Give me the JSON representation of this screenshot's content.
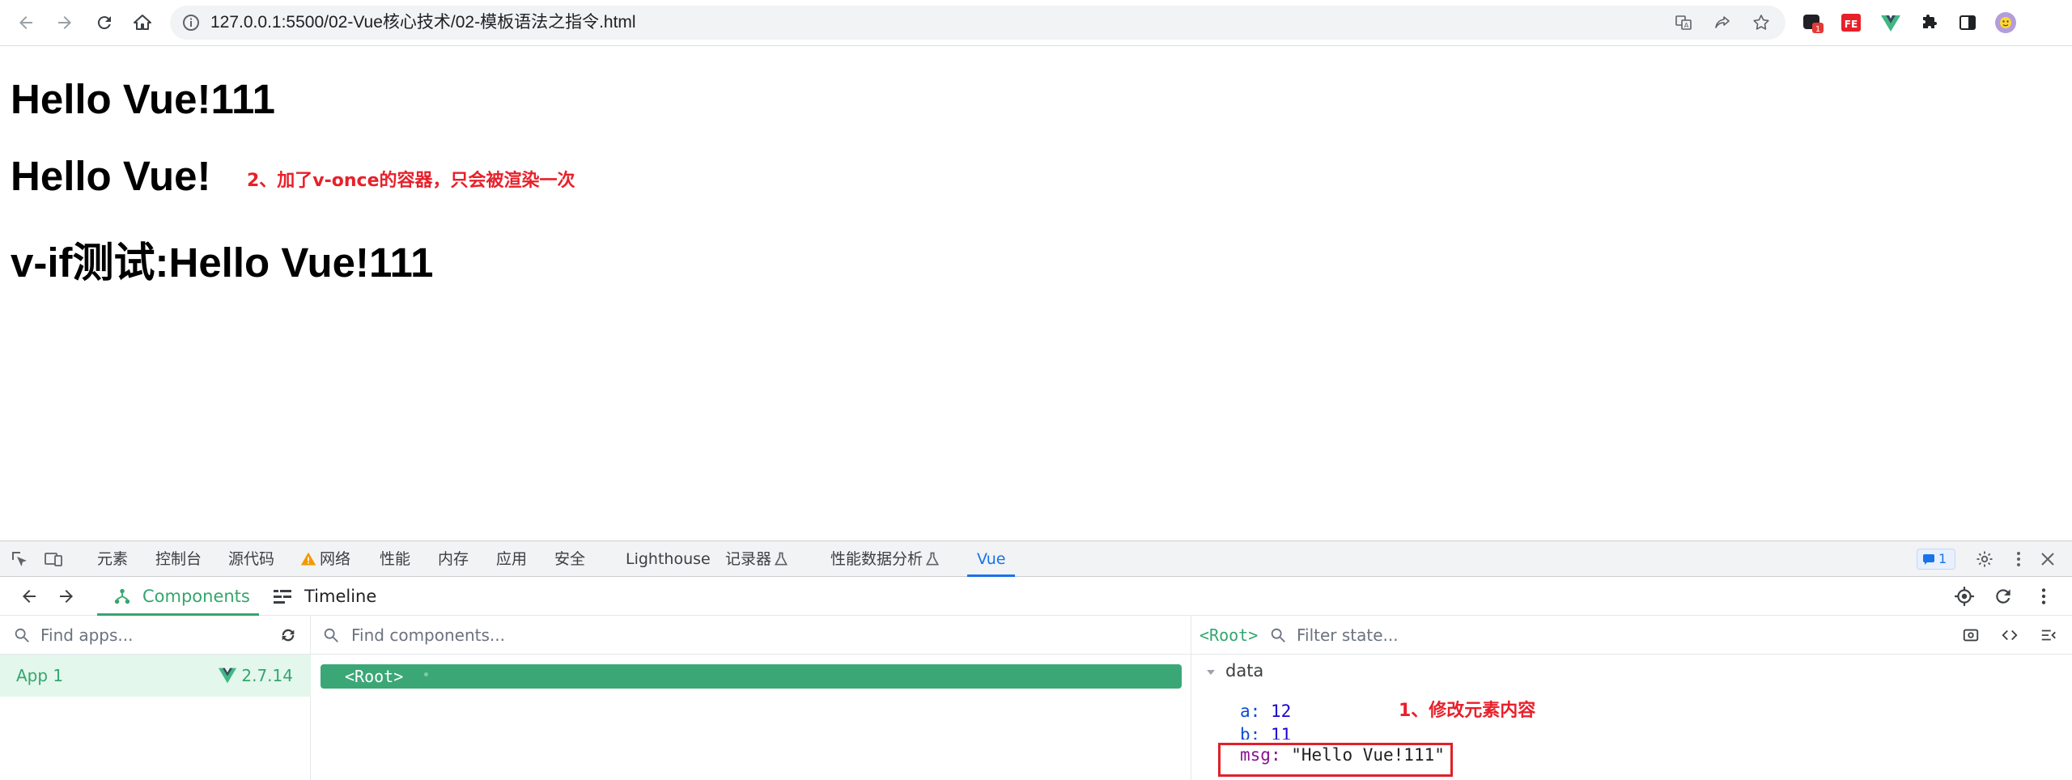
{
  "browser": {
    "url": "127.0.0.1:5500/02-Vue核心技术/02-模板语法之指令.html",
    "ext_badge": "1",
    "colors": {
      "accent": "#1a73e8",
      "vue_green": "#35a66d"
    }
  },
  "page": {
    "line1": "Hello Vue!111",
    "line2": "Hello Vue!",
    "line3": "v-if测试:Hello Vue!111",
    "annotation_once": "2、加了v-once的容器，只会被渲染一次",
    "annotation_edit": "1、修改元素内容"
  },
  "devtools": {
    "tabs": [
      "元素",
      "控制台",
      "源代码",
      "网络",
      "性能",
      "内存",
      "应用",
      "安全",
      "Lighthouse",
      "记录器",
      "性能数据分析",
      "Vue"
    ],
    "issues_count": "1",
    "vue": {
      "tab_components": "Components",
      "tab_timeline": "Timeline",
      "find_apps_placeholder": "Find apps...",
      "find_components_placeholder": "Find components...",
      "filter_state_placeholder": "Filter state...",
      "app_name": "App 1",
      "vue_version": "2.7.14",
      "root_component": "<Root>",
      "state_root": "<Root>",
      "data_section": "data",
      "state": [
        {
          "key": "a",
          "value": "12"
        },
        {
          "key": "b",
          "value": "11"
        },
        {
          "key": "msg",
          "value": "\"Hello Vue!111\""
        }
      ]
    }
  }
}
